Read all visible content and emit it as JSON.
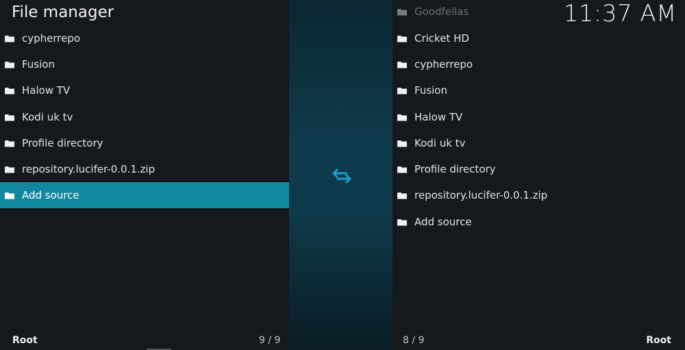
{
  "header": {
    "title": "File manager",
    "clock": "11:37 AM"
  },
  "left_pane": {
    "items": [
      {
        "label": "cypherrepo"
      },
      {
        "label": "Fusion"
      },
      {
        "label": "Halow TV"
      },
      {
        "label": "Kodi uk tv"
      },
      {
        "label": "Profile directory"
      },
      {
        "label": "repository.lucifer-0.0.1.zip"
      },
      {
        "label": "Add source"
      }
    ],
    "selected_item": "Add source",
    "footer_label": "Root",
    "count": "9 / 9"
  },
  "right_pane": {
    "items": [
      {
        "label": "Goodfellas"
      },
      {
        "label": "Cricket HD"
      },
      {
        "label": "cypherrepo"
      },
      {
        "label": "Fusion"
      },
      {
        "label": "Halow TV"
      },
      {
        "label": "Kodi uk tv"
      },
      {
        "label": "Profile directory"
      },
      {
        "label": "repository.lucifer-0.0.1.zip"
      },
      {
        "label": "Add source"
      }
    ],
    "footer_label": "Root",
    "count": "8 / 9"
  },
  "icons": {
    "folder": "folder-icon",
    "swap": "swap-arrows-icon"
  },
  "colors": {
    "selection": "#12889f",
    "accent": "#1aa3c9",
    "background": "#15181c"
  }
}
